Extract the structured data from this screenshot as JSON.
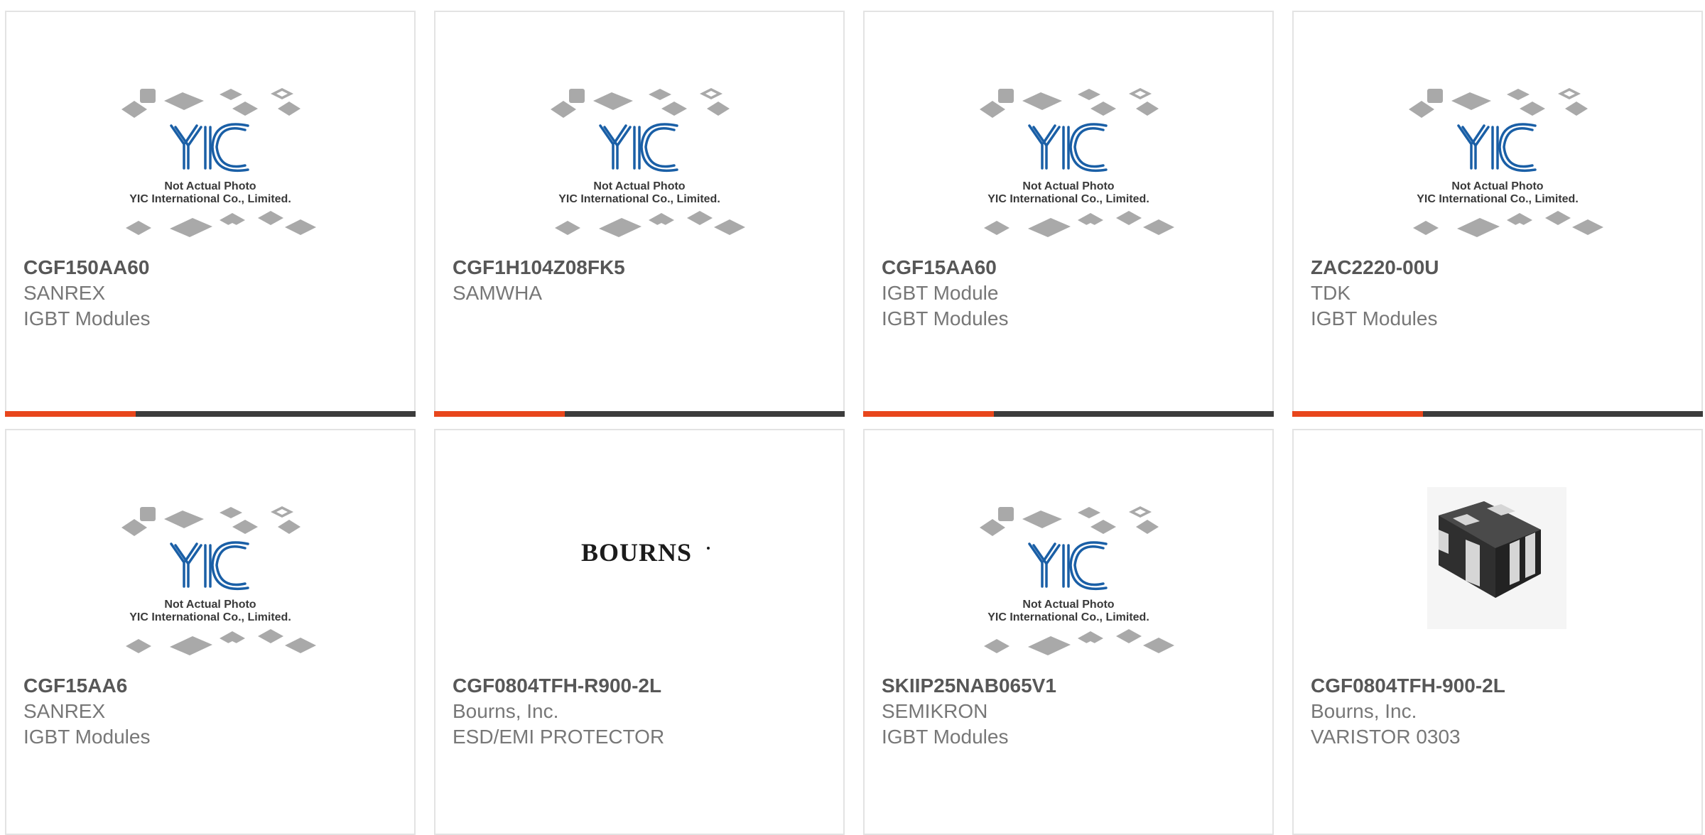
{
  "colors": {
    "accent": "#e8461c",
    "bar": "#3c3c3c",
    "logo_blue": "#1a5fa6",
    "border": "#e3e3e3"
  },
  "products": [
    {
      "part_number": "CGF150AA60",
      "manufacturer": "SANREX",
      "category": "IGBT Modules",
      "image": "placeholder-photo",
      "placeholder_caption_1": "Not Actual Photo",
      "placeholder_caption_2": "YIC International Co., Limited."
    },
    {
      "part_number": "CGF1H104Z08FK5",
      "manufacturer": "SAMWHA",
      "category": "",
      "image": "placeholder-photo",
      "placeholder_caption_1": "Not Actual Photo",
      "placeholder_caption_2": "YIC International Co., Limited."
    },
    {
      "part_number": "CGF15AA60",
      "manufacturer": "IGBT Module",
      "category": "IGBT Modules",
      "image": "placeholder-photo",
      "placeholder_caption_1": "Not Actual Photo",
      "placeholder_caption_2": "YIC International Co., Limited."
    },
    {
      "part_number": "ZAC2220-00U",
      "manufacturer": "TDK",
      "category": "IGBT Modules",
      "image": "placeholder-photo",
      "placeholder_caption_1": "Not Actual Photo",
      "placeholder_caption_2": "YIC International Co., Limited."
    },
    {
      "part_number": "CGF15AA6",
      "manufacturer": "SANREX",
      "category": "IGBT Modules",
      "image": "placeholder-photo",
      "placeholder_caption_1": "Not Actual Photo",
      "placeholder_caption_2": "YIC International Co., Limited."
    },
    {
      "part_number": "CGF0804TFH-R900-2L",
      "manufacturer": "Bourns, Inc.",
      "category": "ESD/EMI PROTECTOR",
      "image": "bourns-logo",
      "logo_text": "BOURNS"
    },
    {
      "part_number": "SKIIP25NAB065V1",
      "manufacturer": "SEMIKRON",
      "category": "IGBT Modules",
      "image": "placeholder-photo",
      "placeholder_caption_1": "Not Actual Photo",
      "placeholder_caption_2": "YIC International Co., Limited."
    },
    {
      "part_number": "CGF0804TFH-900-2L",
      "manufacturer": "Bourns, Inc.",
      "category": "VARISTOR 0303",
      "image": "chip-photo"
    }
  ]
}
